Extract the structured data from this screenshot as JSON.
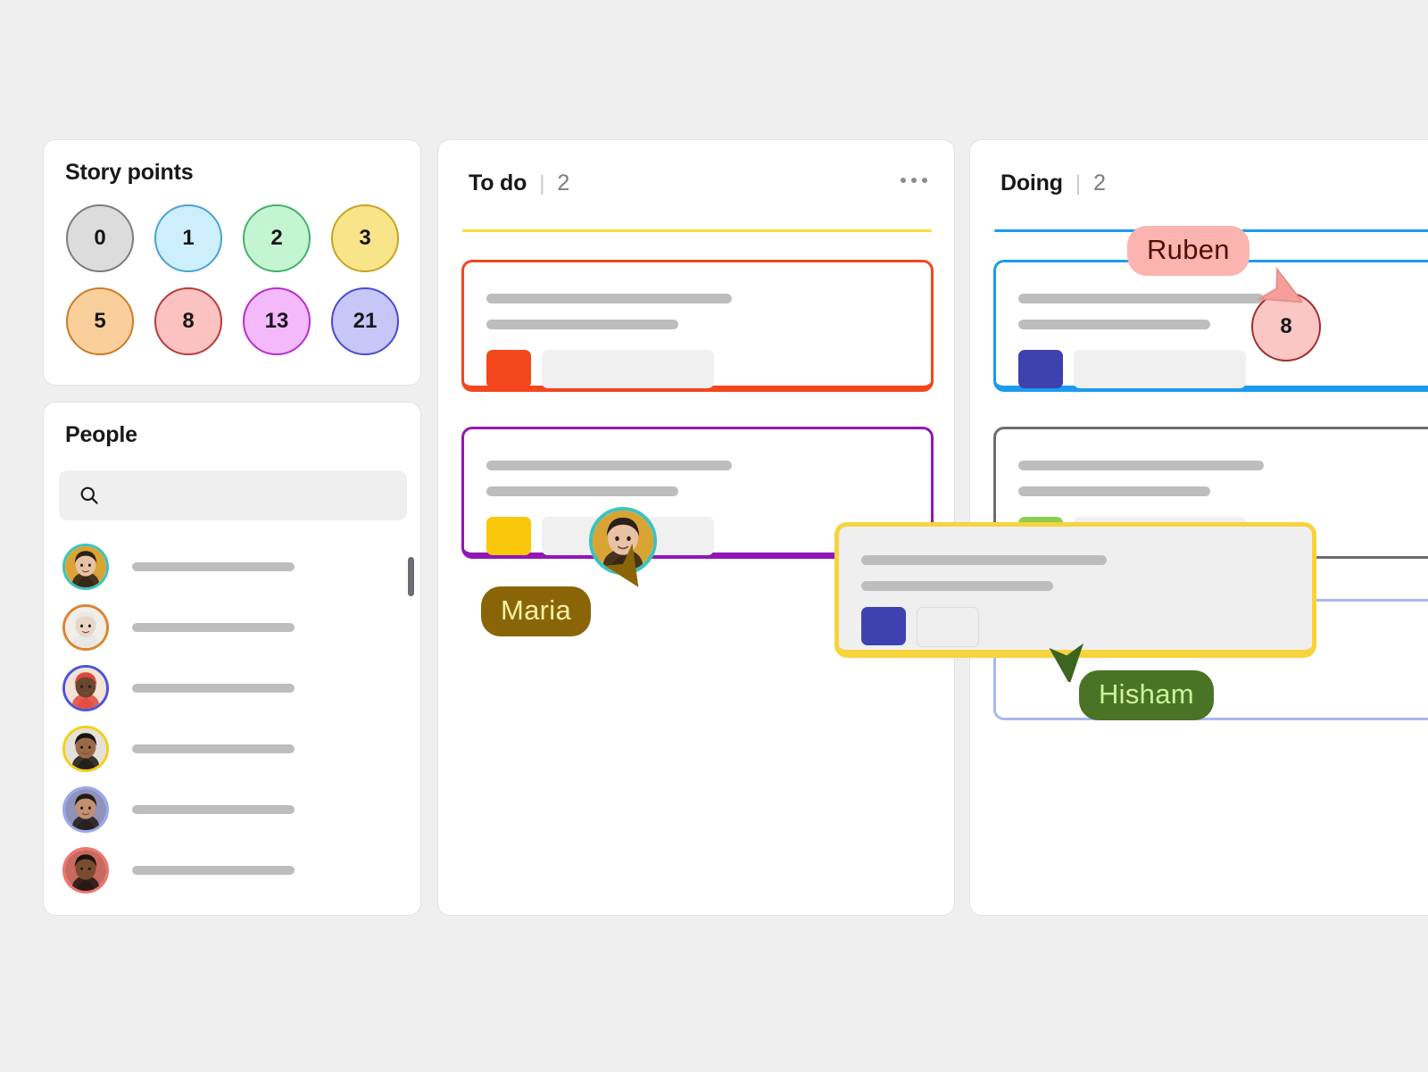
{
  "canvas": {
    "background": "#efefef"
  },
  "story_points": {
    "title": "Story points",
    "chips": [
      {
        "value": "0",
        "fill": "#dcdcdc",
        "stroke": "#7c7c7c"
      },
      {
        "value": "1",
        "fill": "#cdeefb",
        "stroke": "#4aa3cf"
      },
      {
        "value": "2",
        "fill": "#c4f5d2",
        "stroke": "#45b06b"
      },
      {
        "value": "3",
        "fill": "#f8e489",
        "stroke": "#c8a327"
      },
      {
        "value": "5",
        "fill": "#fbcf9b",
        "stroke": "#cc7b28"
      },
      {
        "value": "8",
        "fill": "#fac2c0",
        "stroke": "#b93b3b"
      },
      {
        "value": "13",
        "fill": "#f3b9fb",
        "stroke": "#b52ed0"
      },
      {
        "value": "21",
        "fill": "#c6c6f7",
        "stroke": "#4a4ad6"
      }
    ]
  },
  "people": {
    "title": "People",
    "search": {
      "placeholder": "",
      "value": "",
      "icon": "search-icon"
    },
    "rows": [
      {
        "ring": "#3bc3bd",
        "skin": "#e8c2a4",
        "hair": "#2b2018",
        "bg": "#d9a434"
      },
      {
        "ring": "#de8330",
        "skin": "#ead6c6",
        "hair": "#e8e8e8",
        "bg": "#f2efe9"
      },
      {
        "ring": "#4a55d8",
        "skin": "#6b4630",
        "hair": "#e2453c",
        "bg": "#f3e3d6"
      },
      {
        "ring": "#f2cf18",
        "skin": "#9a6a46",
        "hair": "#1a1410",
        "bg": "#e4e0da"
      },
      {
        "ring": "#9aa6f0",
        "skin": "#c09070",
        "hair": "#231a14",
        "bg": "#8f93b8"
      },
      {
        "ring": "#f0736e",
        "skin": "#7a4c30",
        "hair": "#1d1410",
        "bg": "#c86a5f"
      }
    ]
  },
  "board": {
    "columns": [
      {
        "name": "To do",
        "separator": "|",
        "count": "2",
        "menu_icon": "more-options-icon",
        "rule_color": "#f7dd3c",
        "cards": [
          {
            "border": "#f4461d",
            "tag": "#f4461d"
          },
          {
            "border": "#9315b6",
            "tag": "#f9c80b"
          }
        ]
      },
      {
        "name": "Doing",
        "separator": "|",
        "count": "2",
        "menu_icon": "more-options-icon",
        "rule_color": "#1b9bf0",
        "cards": [
          {
            "border": "#1b9bf0",
            "tag": "#3e42b0"
          },
          {
            "border": "#6d6d6d",
            "tag": "#8cce52"
          }
        ]
      }
    ],
    "drop_zone": {
      "color": "#a9b8ef"
    },
    "drag_card": {
      "border": "#f7d33c",
      "fill": "#efefef",
      "tag": "#3e42b0"
    }
  },
  "cursors": [
    {
      "name": "Maria",
      "label_bg": "#8a6508",
      "label_fg": "#f8f0a8",
      "arrow": "#8a6508",
      "avatar_ring": "#3bc3bd"
    },
    {
      "name": "Ruben",
      "label_bg": "#fbb4b0",
      "label_fg": "#4e0f0c",
      "arrow": "#f69e9a",
      "arrow_stroke": "#e07a76",
      "badge": {
        "value": "8",
        "fill": "#fbc7c5",
        "stroke": "#a32b2b"
      }
    },
    {
      "name": "Hisham",
      "label_bg": "#4b7326",
      "label_fg": "#cdf39a",
      "arrow": "#3d6320"
    }
  ]
}
